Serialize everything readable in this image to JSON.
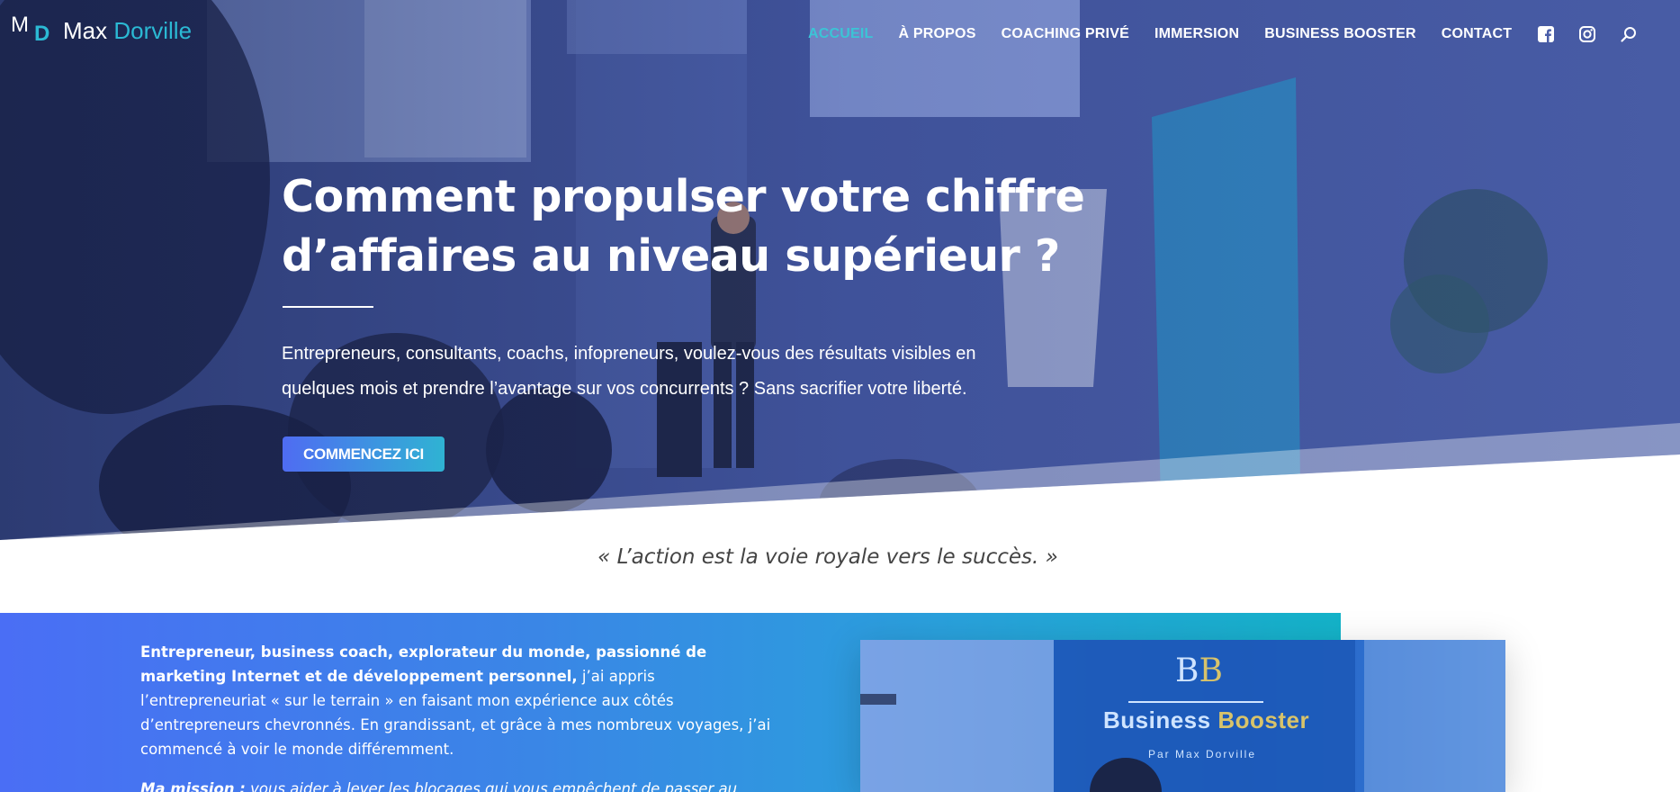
{
  "header": {
    "logo": {
      "mark_m": "M",
      "mark_d": "D",
      "name_first": "Max ",
      "name_last": "Dorville"
    },
    "nav": {
      "items": [
        {
          "label": "ACCUEIL",
          "active": true
        },
        {
          "label": "À PROPOS",
          "active": false
        },
        {
          "label": "COACHING PRIVÉ",
          "active": false
        },
        {
          "label": "IMMERSION",
          "active": false
        },
        {
          "label": "BUSINESS BOOSTER",
          "active": false
        },
        {
          "label": "CONTACT",
          "active": false
        }
      ],
      "icons": [
        "facebook-icon",
        "instagram-icon",
        "search-icon"
      ]
    }
  },
  "hero": {
    "title_line1": "Comment propulser votre chiffre",
    "title_line2": "d’affaires au niveau supérieur  ?",
    "subtitle_line1": "Entrepreneurs, consultants, coachs, infopreneurs, voulez-vous des résultats visibles en",
    "subtitle_line2": "quelques mois et prendre l’avantage sur vos concurrents ? Sans sacrifier votre liberté.",
    "cta_label": "COMMENCEZ ICI"
  },
  "quote": "« L’action est la voie royale vers le succès. »",
  "about": {
    "bold_intro": "Entrepreneur, business coach, explorateur du monde, passionné de marketing Internet et de développement personnel,",
    "body": " j’ai appris l’entrepreneuriat « sur le terrain » en faisant mon expérience aux côtés d’entrepreneurs chevronnés. En grandissant, et grâce à mes nombreux voyages, j’ai commencé à voir le monde différemment.",
    "mission_label": "Ma mission :",
    "mission_text": " vous aider à lever les blocages qui vous empêchent de passer au",
    "photo_banner": {
      "logo_b1": "B",
      "logo_b2": "B",
      "name_part1": "Business ",
      "name_part2": "Booster",
      "byline": "Par Max Dorville"
    }
  },
  "colors": {
    "accent": "#3bc4d6",
    "cta_start": "#4f6cf2",
    "cta_end": "#2fb3d3",
    "section_start": "#4a6ef5",
    "section_end": "#14b3c9"
  }
}
